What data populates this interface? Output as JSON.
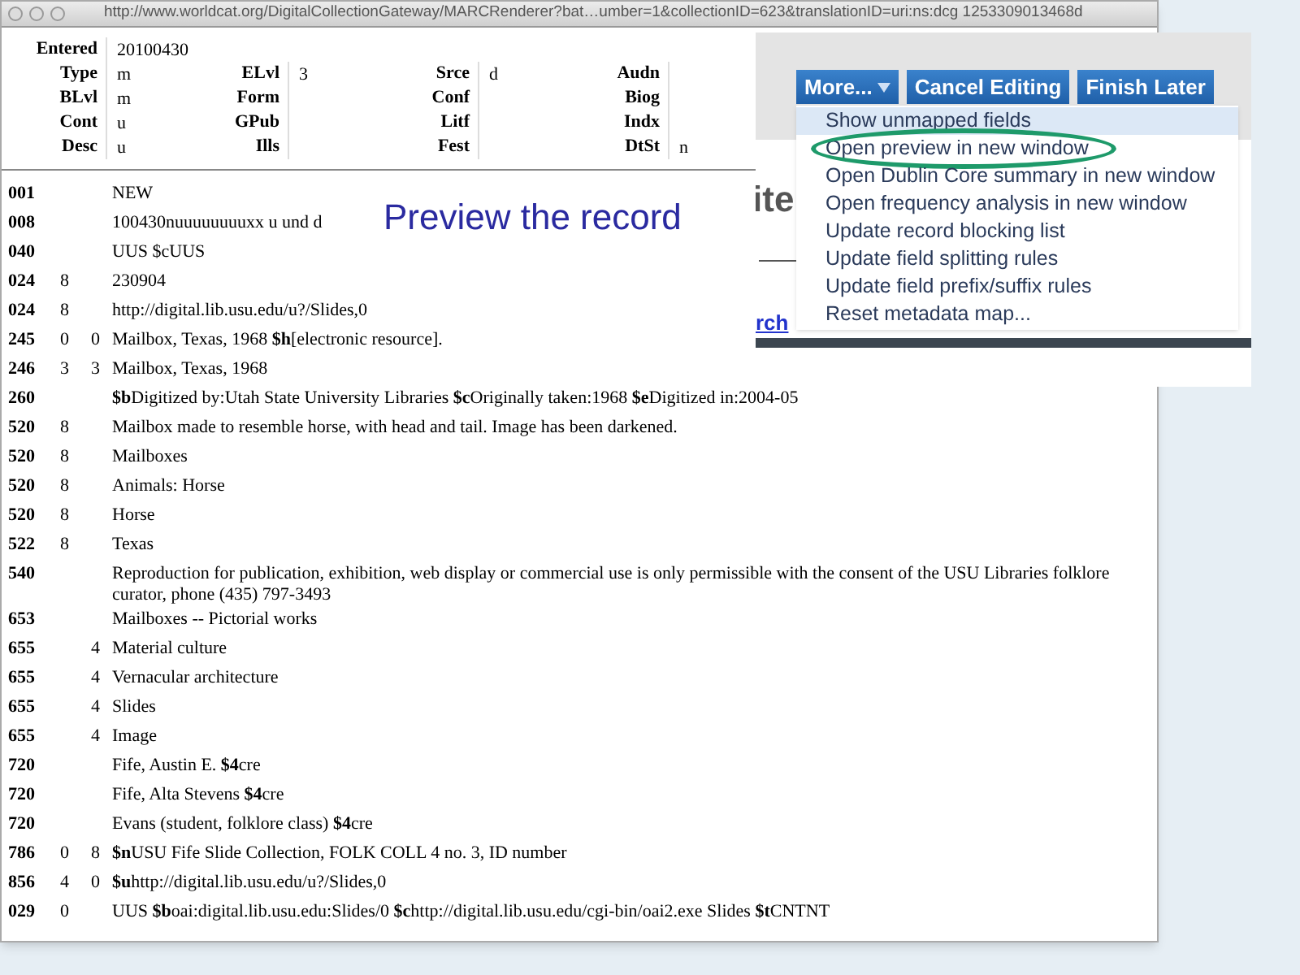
{
  "browser": {
    "url": "http://www.worldcat.org/DigitalCollectionGateway/MARCRenderer?bat…umber=1&collectionID=623&translationID=uri:ns:dcg 1253309013468d"
  },
  "fixed_fields": [
    [
      {
        "label": "Entered",
        "value": "20100430"
      }
    ],
    [
      {
        "label": "Type",
        "value": "m"
      },
      {
        "label": "ELvl",
        "value": "3"
      },
      {
        "label": "Srce",
        "value": "d"
      },
      {
        "label": "Audn"
      }
    ],
    [
      {
        "label": "BLvl",
        "value": "m"
      },
      {
        "label": "Form"
      },
      {
        "label": "Conf"
      },
      {
        "label": "Biog"
      }
    ],
    [
      {
        "label": "Cont",
        "value": "u"
      },
      {
        "label": "GPub"
      },
      {
        "label": "Litf"
      },
      {
        "label": "Indx"
      }
    ],
    [
      {
        "label": "Desc",
        "value": "u"
      },
      {
        "label": "Ills"
      },
      {
        "label": "Fest"
      },
      {
        "label": "DtSt",
        "value": "n"
      }
    ]
  ],
  "fields": [
    {
      "tag": "001",
      "value": "NEW"
    },
    {
      "tag": "008",
      "value": "100430nuuuuuuuuxx u und d"
    },
    {
      "tag": "040",
      "value": "UUS $cUUS"
    },
    {
      "tag": "024",
      "ind1": "8",
      "value": "230904"
    },
    {
      "tag": "024",
      "ind1": "8",
      "value": "http://digital.lib.usu.edu/u?/Slides,0"
    },
    {
      "tag": "245",
      "ind1": "0",
      "ind2": "0",
      "value": "Mailbox, Texas, 1968 **$h**[electronic resource]."
    },
    {
      "tag": "246",
      "ind1": "3",
      "ind2": "3",
      "value": "Mailbox, Texas, 1968"
    },
    {
      "tag": "260",
      "value": "**$b**Digitized by:Utah State University Libraries **$c**Originally taken:1968 **$e**Digitized in:2004-05"
    },
    {
      "tag": "520",
      "ind1": "8",
      "value": "Mailbox made to resemble horse, with head and tail. Image has been darkened."
    },
    {
      "tag": "520",
      "ind1": "8",
      "value": "Mailboxes"
    },
    {
      "tag": "520",
      "ind1": "8",
      "value": "Animals: Horse"
    },
    {
      "tag": "520",
      "ind1": "8",
      "value": "Horse"
    },
    {
      "tag": "522",
      "ind1": "8",
      "value": "Texas"
    },
    {
      "tag": "540",
      "value": "Reproduction for publication, exhibition, web display or commercial use is only permissible with the consent of the USU Libraries folklore curator, phone (435) 797-3493"
    },
    {
      "tag": "653",
      "value": "Mailboxes -- Pictorial works"
    },
    {
      "tag": "655",
      "ind2": "4",
      "value": "Material culture"
    },
    {
      "tag": "655",
      "ind2": "4",
      "value": "Vernacular architecture"
    },
    {
      "tag": "655",
      "ind2": "4",
      "value": "Slides"
    },
    {
      "tag": "655",
      "ind2": "4",
      "value": "Image"
    },
    {
      "tag": "720",
      "value": "Fife, Austin E. **$4**cre"
    },
    {
      "tag": "720",
      "value": "Fife, Alta Stevens **$4**cre"
    },
    {
      "tag": "720",
      "value": "Evans (student, folklore class) **$4**cre"
    },
    {
      "tag": "786",
      "ind1": "0",
      "ind2": "8",
      "value": "**$n**USU Fife Slide Collection, FOLK COLL 4 no. 3, ID number"
    },
    {
      "tag": "856",
      "ind1": "4",
      "ind2": "0",
      "value": "**$u**http://digital.lib.usu.edu/u?/Slides,0"
    },
    {
      "tag": "029",
      "ind1": "0",
      "value": "UUS **$b**oai:digital.lib.usu.edu:Slides/0 **$c**http://digital.lib.usu.edu/cgi-bin/oai2.exe Slides **$t**CNTNT"
    }
  ],
  "caption": "Preview the record",
  "inset": {
    "heading_fragment": "ite",
    "link_fragment": "rch",
    "buttons": [
      {
        "label": "More...",
        "kind": "dropdown"
      },
      {
        "label": "Cancel Editing",
        "kind": "plain"
      },
      {
        "label": "Finish Later",
        "kind": "plain"
      }
    ],
    "menu": [
      {
        "label": "Show unmapped fields",
        "selected": true,
        "circled": false
      },
      {
        "label": "Open preview in new window",
        "selected": false,
        "circled": true
      },
      {
        "label": "Open Dublin Core summary in new window",
        "selected": false,
        "circled": false
      },
      {
        "label": "Open frequency analysis in new window",
        "selected": false,
        "circled": false
      },
      {
        "label": "Update record blocking list",
        "selected": false,
        "circled": false
      },
      {
        "label": "Update field splitting rules",
        "selected": false,
        "circled": false
      },
      {
        "label": "Update field prefix/suffix rules",
        "selected": false,
        "circled": false
      },
      {
        "label": "Reset metadata map...",
        "selected": false,
        "circled": false
      }
    ]
  }
}
